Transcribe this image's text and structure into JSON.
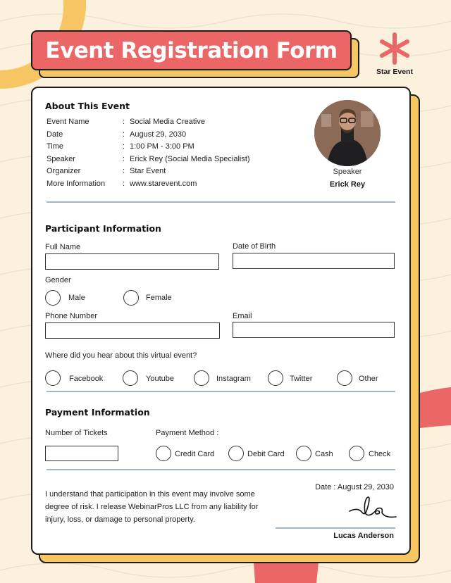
{
  "header": {
    "title": "Event Registration Form",
    "logo_icon": "asterisk-icon",
    "logo_text": "Star Event"
  },
  "colors": {
    "background": "#fbf1dd",
    "accent_red": "#eb6767",
    "accent_yellow": "#f6c564",
    "divider": "#a8b4c8"
  },
  "about": {
    "title": "About This Event",
    "rows": [
      {
        "label": "Event Name",
        "value": "Social Media Creative"
      },
      {
        "label": "Date",
        "value": "August 29, 2030"
      },
      {
        "label": "Time",
        "value": "1:00 PM - 3:00 PM"
      },
      {
        "label": "Speaker",
        "value": "Erick Rey (Social Media Specialist)"
      },
      {
        "label": "Organizer",
        "value": "Star Event"
      },
      {
        "label": "More Information",
        "value": "www.starevent.com"
      }
    ],
    "separator": ":",
    "speaker_caption": "Speaker",
    "speaker_name": "Erick Rey"
  },
  "participant": {
    "title": "Participant Information",
    "full_name": {
      "label": "Full Name",
      "value": ""
    },
    "date_of_birth": {
      "label": "Date of Birth",
      "value": ""
    },
    "gender": {
      "label": "Gender",
      "options": [
        "Male",
        "Female"
      ]
    },
    "phone": {
      "label": "Phone Number",
      "value": ""
    },
    "email": {
      "label": "Email",
      "value": ""
    },
    "source": {
      "label": "Where did you hear about this virtual event?",
      "options": [
        "Facebook",
        "Youtube",
        "Instagram",
        "Twitter",
        "Other"
      ]
    }
  },
  "payment": {
    "title": "Payment Information",
    "tickets": {
      "label": "Number of Tickets",
      "value": ""
    },
    "method": {
      "label": "Payment Method :",
      "options": [
        "Credit Card",
        "Debit Card",
        "Cash",
        "Check"
      ]
    }
  },
  "agreement": {
    "text": "I understand that participation in this event may involve some degree of risk. I release WebinarPros LLC from any liability for injury, loss, or damage to personal property.",
    "date": "Date : August 29, 2030",
    "signer": "Lucas Anderson"
  }
}
